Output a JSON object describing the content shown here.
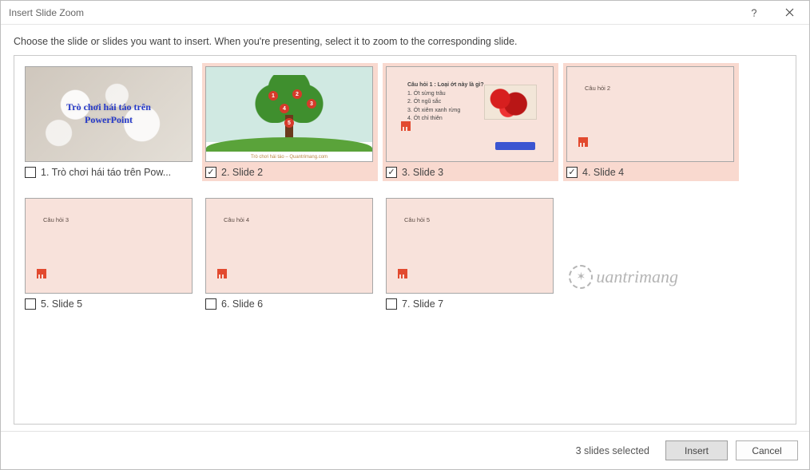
{
  "title": "Insert Slide Zoom",
  "instruction": "Choose the slide or slides you want to insert. When you're presenting, select it to zoom to the corresponding slide.",
  "slides": [
    {
      "label": "1. Trò chơi hái táo trên Pow...",
      "selected": false,
      "title_text": "Trò chơi hái táo trên\nPowerPoint"
    },
    {
      "label": "2. Slide 2",
      "selected": true,
      "caption": "Trò chơi hái táo – Quantrimang.com",
      "apples": [
        "1",
        "2",
        "3",
        "4",
        "5"
      ]
    },
    {
      "label": "3. Slide 3",
      "selected": true,
      "question_title": "Câu hỏi 1 : Loại ớt này là gì?",
      "options": [
        "1.  Ớt sừng trâu",
        "2.  Ớt ngũ sắc",
        "3.  Ớt xiêm xanh rừng",
        "4.  Ớt chỉ thiên"
      ]
    },
    {
      "label": "4. Slide 4",
      "selected": true,
      "q": "Câu hỏi 2"
    },
    {
      "label": "5. Slide 5",
      "selected": false,
      "q": "Câu hỏi 3"
    },
    {
      "label": "6. Slide 6",
      "selected": false,
      "q": "Câu hỏi 4"
    },
    {
      "label": "7. Slide 7",
      "selected": false,
      "q": "Câu hỏi 5"
    }
  ],
  "status": "3 slides selected",
  "buttons": {
    "insert": "Insert",
    "cancel": "Cancel"
  },
  "watermark": "uantrimang"
}
